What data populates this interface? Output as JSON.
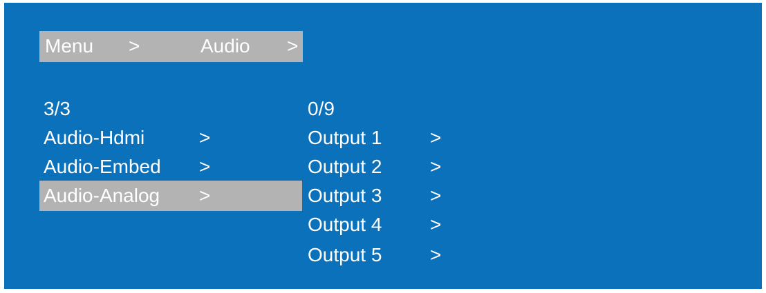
{
  "breadcrumb": {
    "items": [
      "Menu",
      "Audio"
    ],
    "separator": ">"
  },
  "left_column": {
    "counter": "3/3",
    "items": [
      {
        "label": "Audio-Hdmi",
        "arrow": ">"
      },
      {
        "label": "Audio-Embed",
        "arrow": ">"
      },
      {
        "label": "Audio-Analog",
        "arrow": ">",
        "selected": true
      }
    ]
  },
  "right_column": {
    "counter": "0/9",
    "items": [
      {
        "label": "Output 1",
        "arrow": ">"
      },
      {
        "label": "Output 2",
        "arrow": ">"
      },
      {
        "label": "Output 3",
        "arrow": ">"
      },
      {
        "label": "Output 4",
        "arrow": ">"
      },
      {
        "label": "Output 5",
        "arrow": ">"
      }
    ]
  },
  "colors": {
    "background": "#0c71bb",
    "highlight": "#b3b3b3",
    "text": "#ffffff"
  }
}
